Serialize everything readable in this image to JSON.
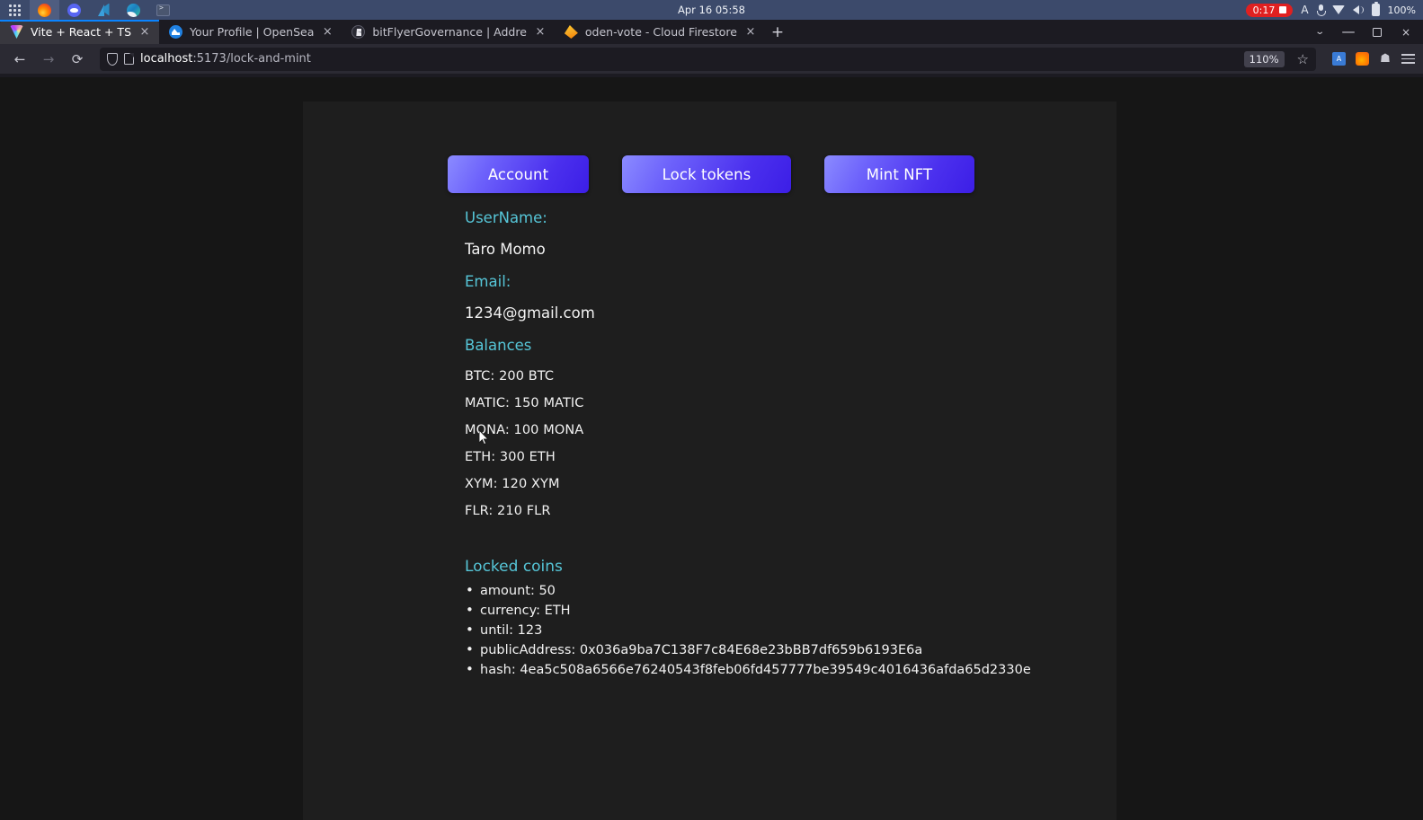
{
  "system_bar": {
    "launcher_icons": [
      "apps-grid-icon",
      "firefox-icon",
      "discord-icon",
      "vscode-icon",
      "edge-icon",
      "terminal-icon"
    ],
    "clock": "Apr 16 05:58",
    "recording": {
      "time": "0:17",
      "icon": "stop-square-icon"
    },
    "keyboard_layout": "A",
    "tray_icons": [
      "microphone-icon",
      "wifi-icon",
      "volume-icon",
      "battery-icon"
    ],
    "battery_percent": "100%",
    "accent_color": "#3c4a6b",
    "recording_color": "#e02020"
  },
  "browser": {
    "tabs": [
      {
        "title": "Vite + React + TS",
        "favicon": "vite-icon",
        "active": true,
        "close": "×"
      },
      {
        "title": "Your Profile | OpenSea",
        "favicon": "opensea-icon",
        "active": false,
        "close": "×"
      },
      {
        "title": "bitFlyerGovernance | Addre",
        "favicon": "bitflyer-icon",
        "active": false,
        "close": "×"
      },
      {
        "title": "oden-vote - Cloud Firestore",
        "favicon": "firestore-icon",
        "active": false,
        "close": "×"
      }
    ],
    "new_tab_label": "+",
    "window_controls": {
      "tab_list": "⌄",
      "minimize": "—",
      "maximize": "□",
      "close": "×"
    },
    "nav": {
      "back": "←",
      "forward": "→",
      "reload": "⟳"
    },
    "url": {
      "host": "localhost",
      "path": ":5173/lock-and-mint",
      "full": "localhost:5173/lock-and-mint"
    },
    "zoom_level": "110%",
    "bookmark_icon": "star-icon",
    "extensions": [
      "translate-icon",
      "metamask-fox-icon",
      "pocket-icon"
    ],
    "menu_icon": "hamburger-menu-icon"
  },
  "page": {
    "buttons": [
      {
        "label": "Account"
      },
      {
        "label": "Lock tokens"
      },
      {
        "label": "Mint NFT"
      }
    ],
    "username_label": "UserName:",
    "username_value": "Taro Momo",
    "email_label": "Email:",
    "email_value": "1234@gmail.com",
    "balances_label": "Balances",
    "balances": [
      "BTC: 200 BTC",
      "MATIC: 150 MATIC",
      "MONA: 100 MONA",
      "ETH: 300 ETH",
      "XYM: 120 XYM",
      "FLR: 210 FLR"
    ],
    "locked_coins_title": "Locked coins",
    "locked_coins": [
      "amount: 50",
      "currency: ETH",
      "until: 123",
      "publicAddress: 0x036a9ba7C138F7c84E68e23bBB7df659b6193E6a",
      "hash: 4ea5c508a6566e76240543f8feb06fd457777be39549c4016436afda65d2330e"
    ],
    "colors": {
      "label": "#56c6d8",
      "value": "#f2f2f2",
      "background": "#1e1e1e",
      "page_background": "#161616",
      "button_gradient_start": "#8b8bff",
      "button_gradient_end": "#3c1ee6"
    }
  }
}
